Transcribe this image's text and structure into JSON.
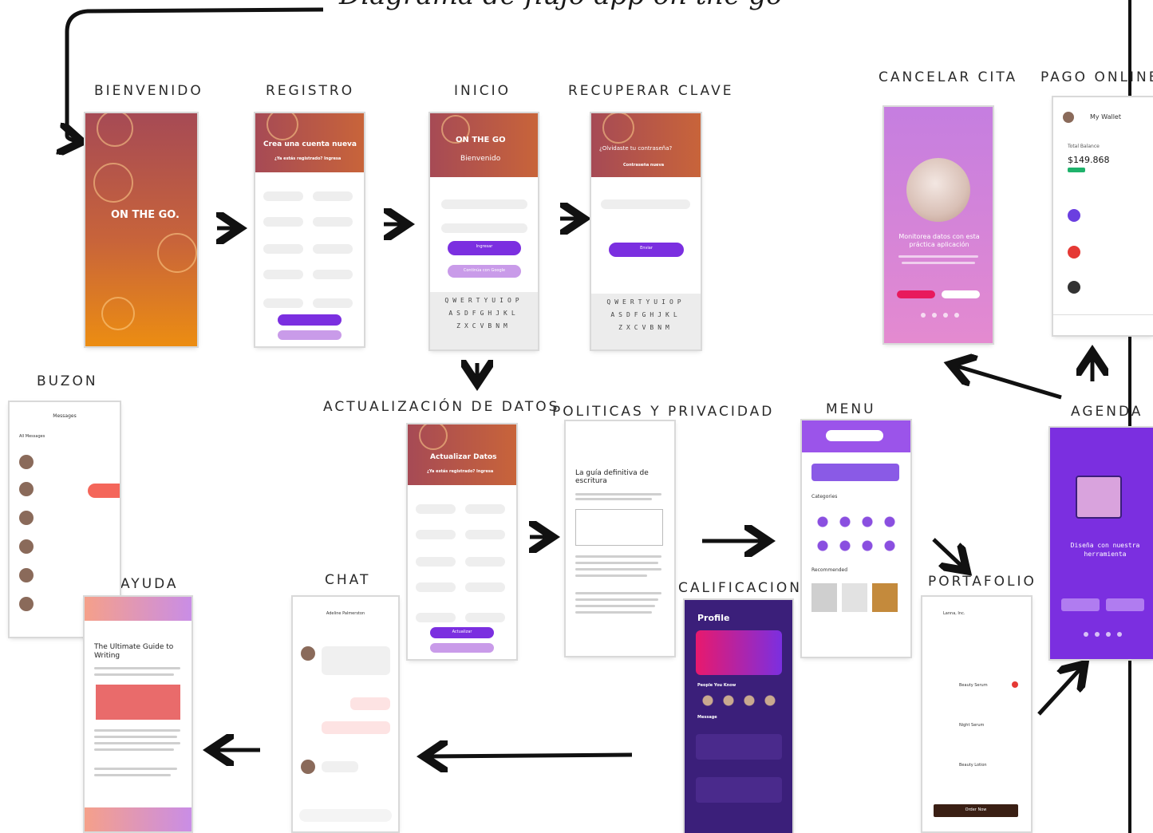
{
  "title_partial": "Diagrama de flujo app on the go",
  "labels": {
    "bienvenido": "BIENVENIDO",
    "registro": "REGISTRO",
    "inicio": "INICIO",
    "recuperar": "RECUPERAR CLAVE",
    "cancelar": "CANCELAR CITA",
    "pago": "PAGO ONLINE",
    "buzon": "BUZON",
    "actualizacion": "ACTUALIZACIÓN DE DATOS",
    "politicas": "POLITICAS Y PRIVACIDAD",
    "menu": "MENU",
    "agenda": "AGENDA",
    "ayuda": "AYUDA",
    "chat": "CHAT",
    "calificacion": "CALIFICACION",
    "portafolio": "PORTAFOLIO"
  },
  "screens": {
    "bienvenido": {
      "brand": "ON THE GO."
    },
    "registro": {
      "heading": "Crea una cuenta nueva",
      "sub": "¿Ya estás registrado? Ingresa"
    },
    "inicio": {
      "brand": "ON THE GO",
      "welcome": "Bienvenido",
      "login": "Ingresar",
      "google": "Continúa con Google"
    },
    "recuperar": {
      "heading": "¿Olvidaste tu contraseña?",
      "sub": "Contraseña nueva",
      "send": "Enviar"
    },
    "cancelar": {
      "msg": "Monitorea datos con esta práctica aplicación"
    },
    "pago": {
      "wallet": "My Wallet",
      "balance_label": "Total Balance",
      "balance": "$149.868"
    },
    "buzon": {
      "header": "Messages",
      "tab": "All Messages"
    },
    "actualizacion": {
      "heading": "Actualizar Datos",
      "sub": "¿Ya estás registrado? Ingresa",
      "update": "Actualizar"
    },
    "politicas": {
      "heading": "La guía definitiva de escritura"
    },
    "ayuda": {
      "heading": "The Ultimate Guide to Writing"
    },
    "chat": {
      "name": "Adeline Palmerston"
    },
    "calificacion": {
      "header": "Profile",
      "people": "People You Know",
      "message": "Message"
    },
    "menu": {
      "categories": "Categories",
      "recommended": "Recommended"
    },
    "agenda": {
      "msg": "Diseña con nuestra herramienta"
    },
    "portafolio": {
      "company": "Lanna, Inc.",
      "p1": "Beauty Serum",
      "p2": "Night Serum",
      "p3": "Beauty Lotion",
      "order": "Order Now"
    }
  },
  "keyboard": {
    "row1": "QWERTYUIOP",
    "row2": "ASDFGHJKL",
    "row3": "ZXCVBNM"
  },
  "colors": {
    "orange": "#e8870f",
    "brown": "#a64a55",
    "purple": "#7b2fe0",
    "lavender": "#c57ee0",
    "navy": "#3b1f7a"
  }
}
